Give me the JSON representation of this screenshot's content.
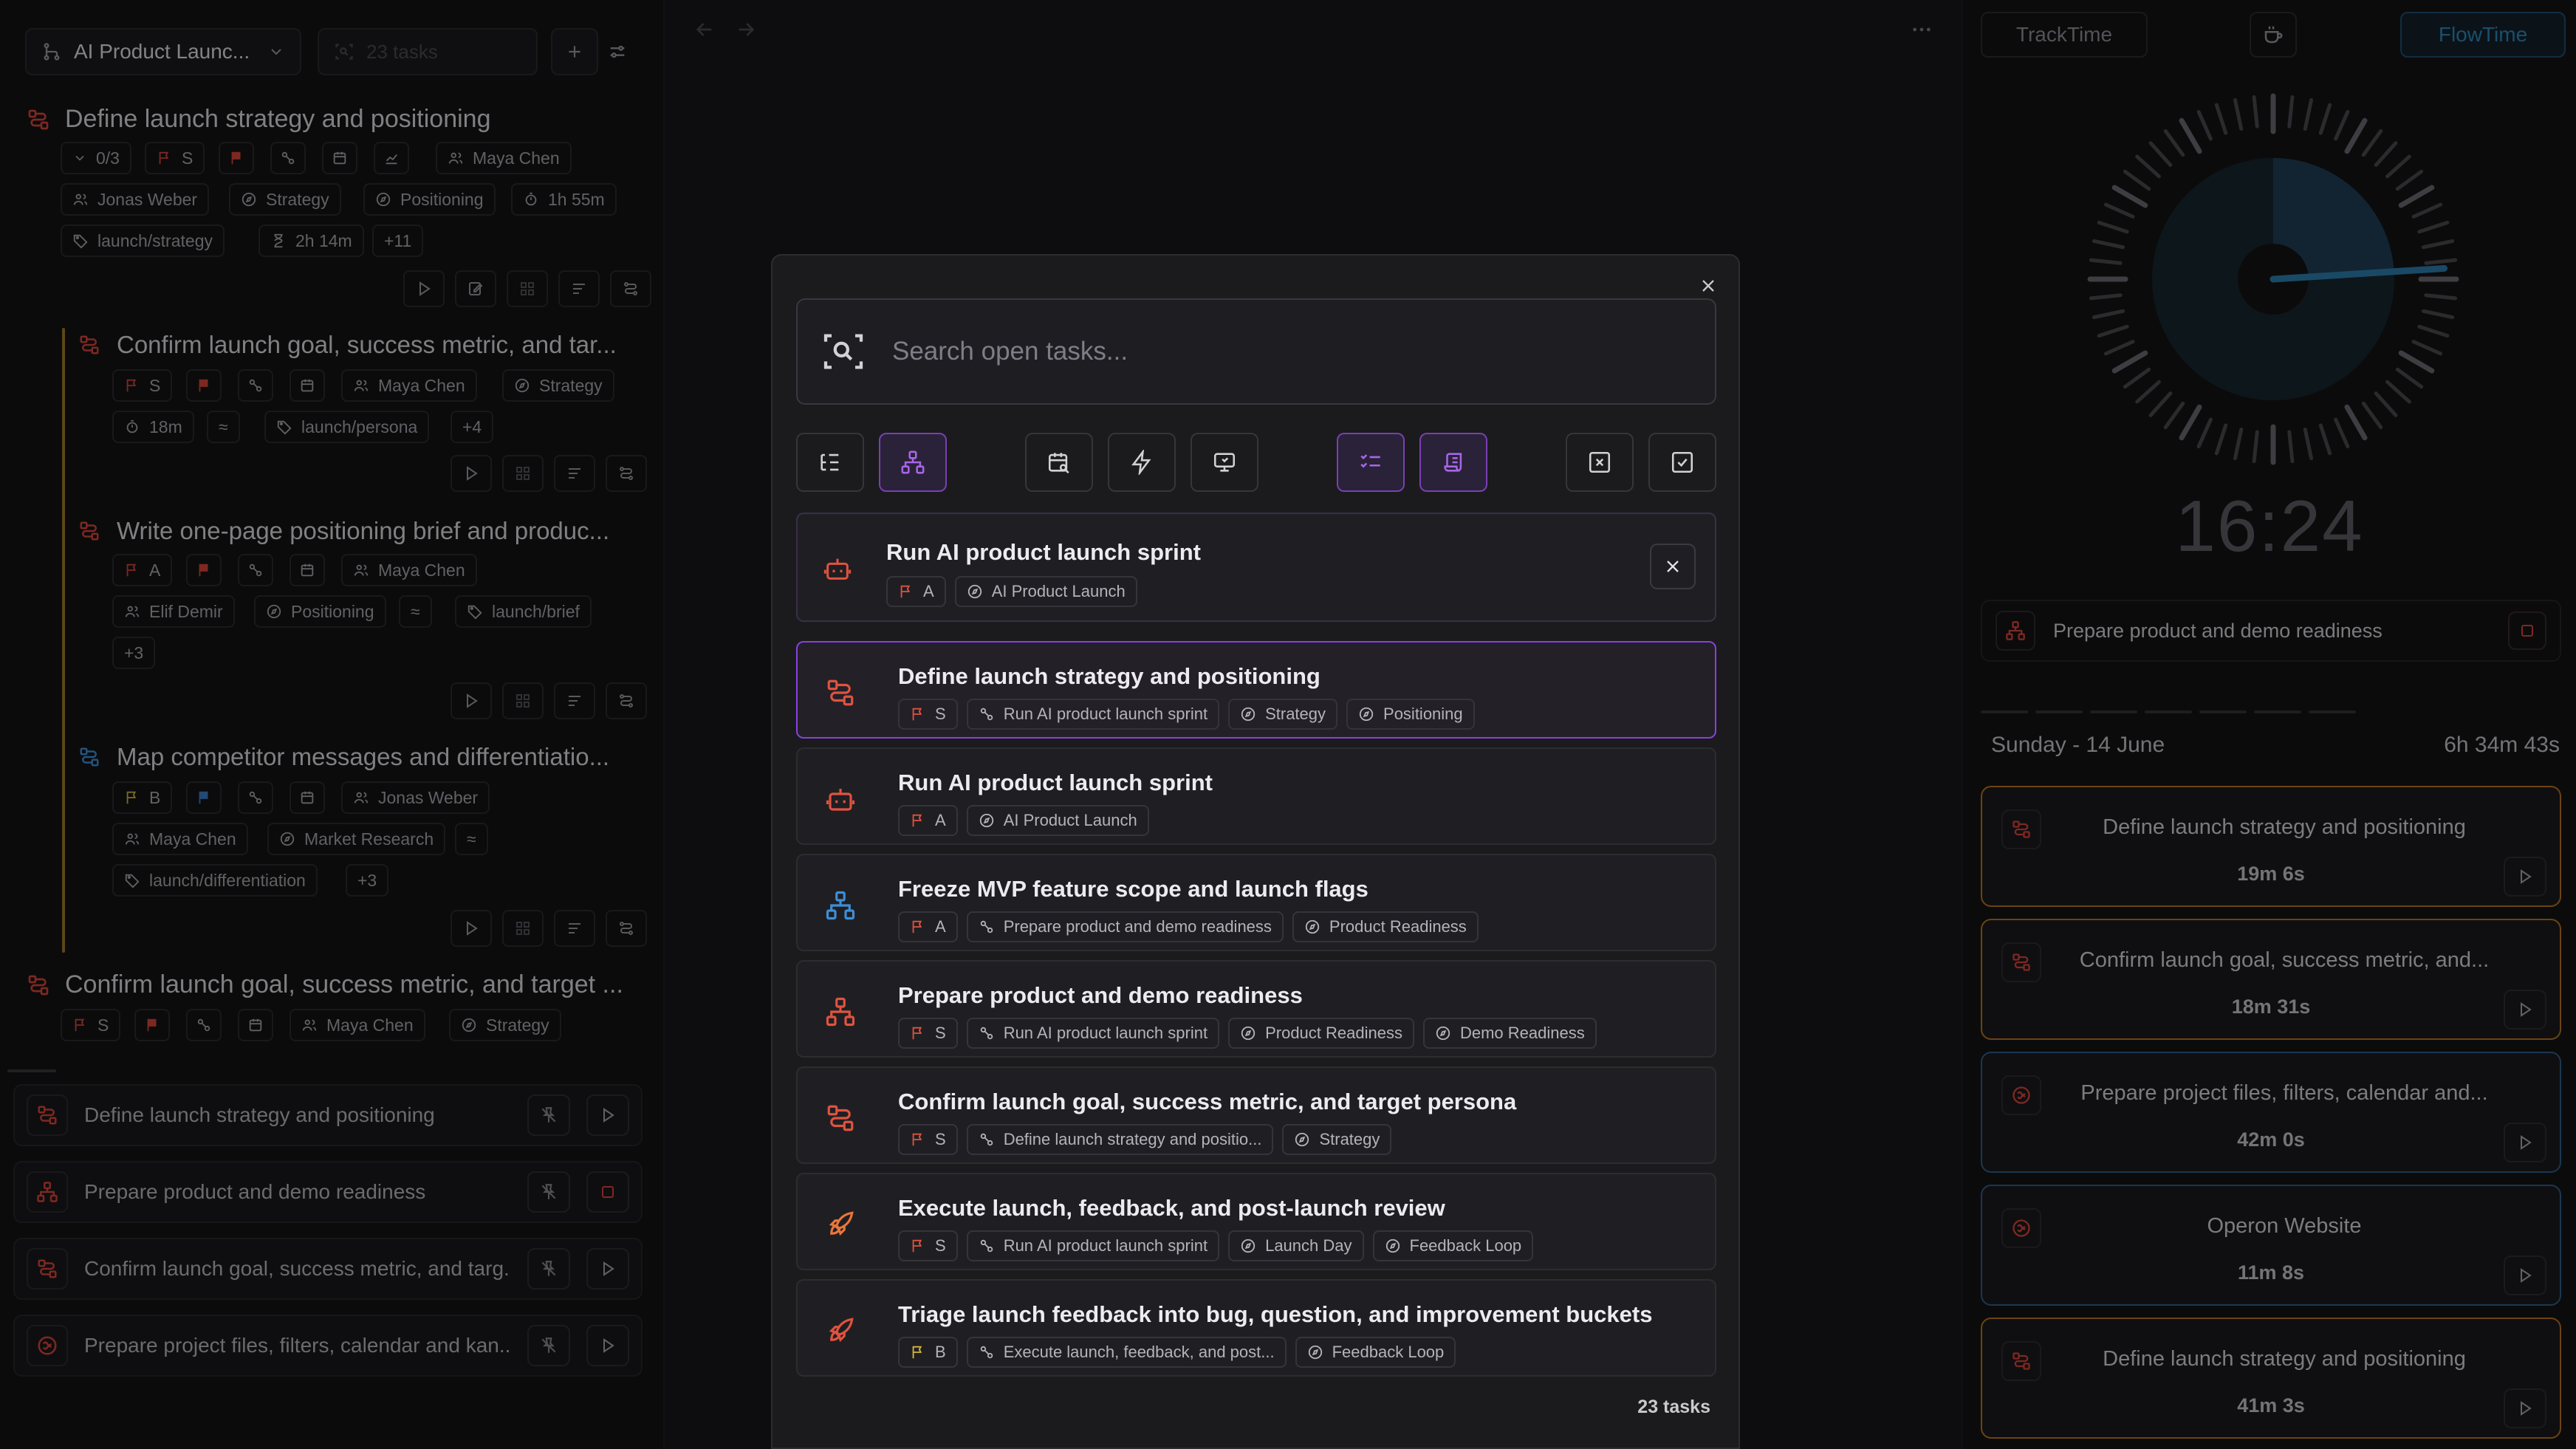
{
  "left": {
    "project_select": "AI Product Launc...",
    "task_count_placeholder": "23 tasks",
    "tasks": [
      {
        "title": "Define launch strategy and positioning",
        "progress": "0/3",
        "priority": "S",
        "assignee": "Maya Chen",
        "assignee2": "Jonas Weber",
        "tag1": "Strategy",
        "tag2": "Positioning",
        "estimate": "1h 55m",
        "label": "launch/strategy",
        "tracked": "2h 14m",
        "more": "+11"
      },
      {
        "title": "Confirm launch goal, success metric, and tar...",
        "priority": "S",
        "assignee": "Maya Chen",
        "tag1": "Strategy",
        "estimate": "18m",
        "approx": "≈",
        "label": "launch/persona",
        "more": "+4"
      },
      {
        "title": "Write one-page positioning brief and produc...",
        "priority": "A",
        "assignee": "Maya Chen",
        "assignee2": "Elif Demir",
        "tag1": "Positioning",
        "approx": "≈",
        "label": "launch/brief",
        "more": "+3"
      },
      {
        "title": "Map competitor messages and differentiatio...",
        "priority": "B",
        "assignee": "Jonas Weber",
        "assignee2": "Maya Chen",
        "tag1": "Market Research",
        "approx": "≈",
        "label": "launch/differentiation",
        "more": "+3"
      },
      {
        "title": "Confirm launch goal, success metric, and target ...",
        "priority": "S",
        "assignee": "Maya Chen",
        "tag1": "Strategy"
      }
    ],
    "pinned": [
      {
        "label": "Define launch strategy and positioning",
        "icon": "workflow-icon",
        "action": "play"
      },
      {
        "label": "Prepare product and demo readiness",
        "icon": "hierarchy-icon",
        "action": "stop"
      },
      {
        "label": "Confirm launch goal, success metric, and targ...",
        "icon": "workflow-icon",
        "action": "play"
      },
      {
        "label": "Prepare project files, filters, calendar and kan...",
        "icon": "target-icon",
        "action": "play"
      }
    ]
  },
  "right": {
    "modes": {
      "track": "TrackTime",
      "flow": "FlowTime"
    },
    "clock_time": "16:24",
    "clock_progress": 0.24,
    "current_task": "Prepare product and demo readiness",
    "day_label": "Sunday - 14 June",
    "day_total": "6h 34m 43s",
    "sessions": [
      {
        "title": "Define launch strategy and positioning",
        "duration": "19m 6s",
        "color": "#b8741f"
      },
      {
        "title": "Confirm launch goal, success metric, and...",
        "duration": "18m 31s",
        "color": "#b8741f"
      },
      {
        "title": "Prepare project files, filters, calendar and...",
        "duration": "42m 0s",
        "color": "#2f5f8a"
      },
      {
        "title": "Operon Website",
        "duration": "11m 8s",
        "color": "#2f5f8a"
      },
      {
        "title": "Define launch strategy and positioning",
        "duration": "41m 3s",
        "color": "#b8741f"
      }
    ]
  },
  "modal": {
    "search_placeholder": "Search open tasks...",
    "count": "23 tasks",
    "pinned_item": {
      "title": "Run AI product launch sprint",
      "priority": "A",
      "project": "AI Product Launch"
    },
    "results": [
      {
        "title": "Define launch strategy and positioning",
        "priority": "S",
        "chips": [
          "Run AI product launch sprint",
          "Strategy",
          "Positioning"
        ],
        "icon": "workflow-icon",
        "color": "#e0533f"
      },
      {
        "title": "Run AI product launch sprint",
        "priority": "A",
        "chips": [
          "AI Product Launch"
        ],
        "icon": "robot-icon",
        "color": "#e0533f"
      },
      {
        "title": "Freeze MVP feature scope and launch flags",
        "priority": "A",
        "chips": [
          "Prepare product and demo readiness",
          "Product Readiness"
        ],
        "icon": "hierarchy-icon",
        "color": "#3d8fd8"
      },
      {
        "title": "Prepare product and demo readiness",
        "priority": "S",
        "chips": [
          "Run AI product launch sprint",
          "Product Readiness",
          "Demo Readiness"
        ],
        "icon": "hierarchy-icon",
        "color": "#e0533f"
      },
      {
        "title": "Confirm launch goal, success metric, and target persona",
        "priority": "S",
        "chips": [
          "Define launch strategy and positio...",
          "Strategy"
        ],
        "icon": "workflow-icon",
        "color": "#e0533f"
      },
      {
        "title": "Execute launch, feedback, and post-launch review",
        "priority": "S",
        "chips": [
          "Run AI product launch sprint",
          "Launch Day",
          "Feedback Loop"
        ],
        "icon": "rocket-icon",
        "color": "#e8763a"
      },
      {
        "title": "Triage launch feedback into bug, question, and improvement buckets",
        "priority": "B",
        "chips": [
          "Execute launch, feedback, and post...",
          "Feedback Loop"
        ],
        "icon": "rocket-icon",
        "color": "#e0533f"
      }
    ]
  }
}
